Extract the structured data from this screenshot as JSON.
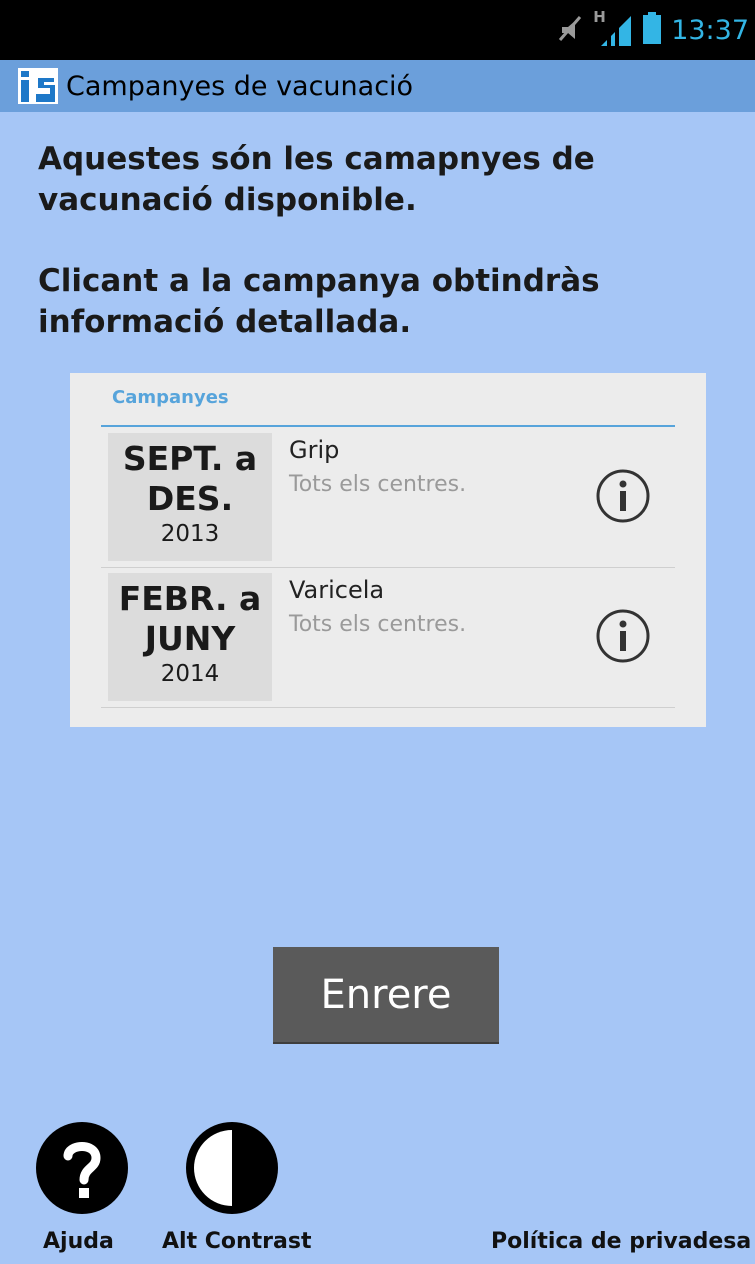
{
  "status_bar": {
    "time": "13:37",
    "network_label": "H",
    "icons": [
      "muted-icon",
      "signal-icon",
      "battery-icon"
    ]
  },
  "action_bar": {
    "logo_text": "iS",
    "title": "Campanyes de vacunació"
  },
  "intro": {
    "line1": "Aquestes són les camapnyes de vacunació disponible.",
    "line2": "Clicant a la campanya obtindràs informació detallada."
  },
  "campaign_list": {
    "header": "Campanyes",
    "items": [
      {
        "date_range_line1": "SEPT. a",
        "date_range_line2": "DES.",
        "year": "2013",
        "name": "Grip",
        "centres": "Tots els centres.",
        "info_icon": "info-icon"
      },
      {
        "date_range_line1": "FEBR. a",
        "date_range_line2": "JUNY",
        "year": "2014",
        "name": "Varicela",
        "centres": "Tots els centres.",
        "info_icon": "info-icon"
      }
    ]
  },
  "buttons": {
    "back_label": "Enrere"
  },
  "footer": {
    "help_label": "Ajuda",
    "help_icon": "help-icon",
    "contrast_label": "Alt Contrast",
    "contrast_icon": "contrast-icon",
    "privacy_label": "Política de privadesa"
  },
  "colors": {
    "background": "#a6c6f6",
    "action_bar": "#6b9fdb",
    "accent": "#57a4db",
    "status_text": "#33b5e5",
    "button": "#5a5a5a"
  }
}
